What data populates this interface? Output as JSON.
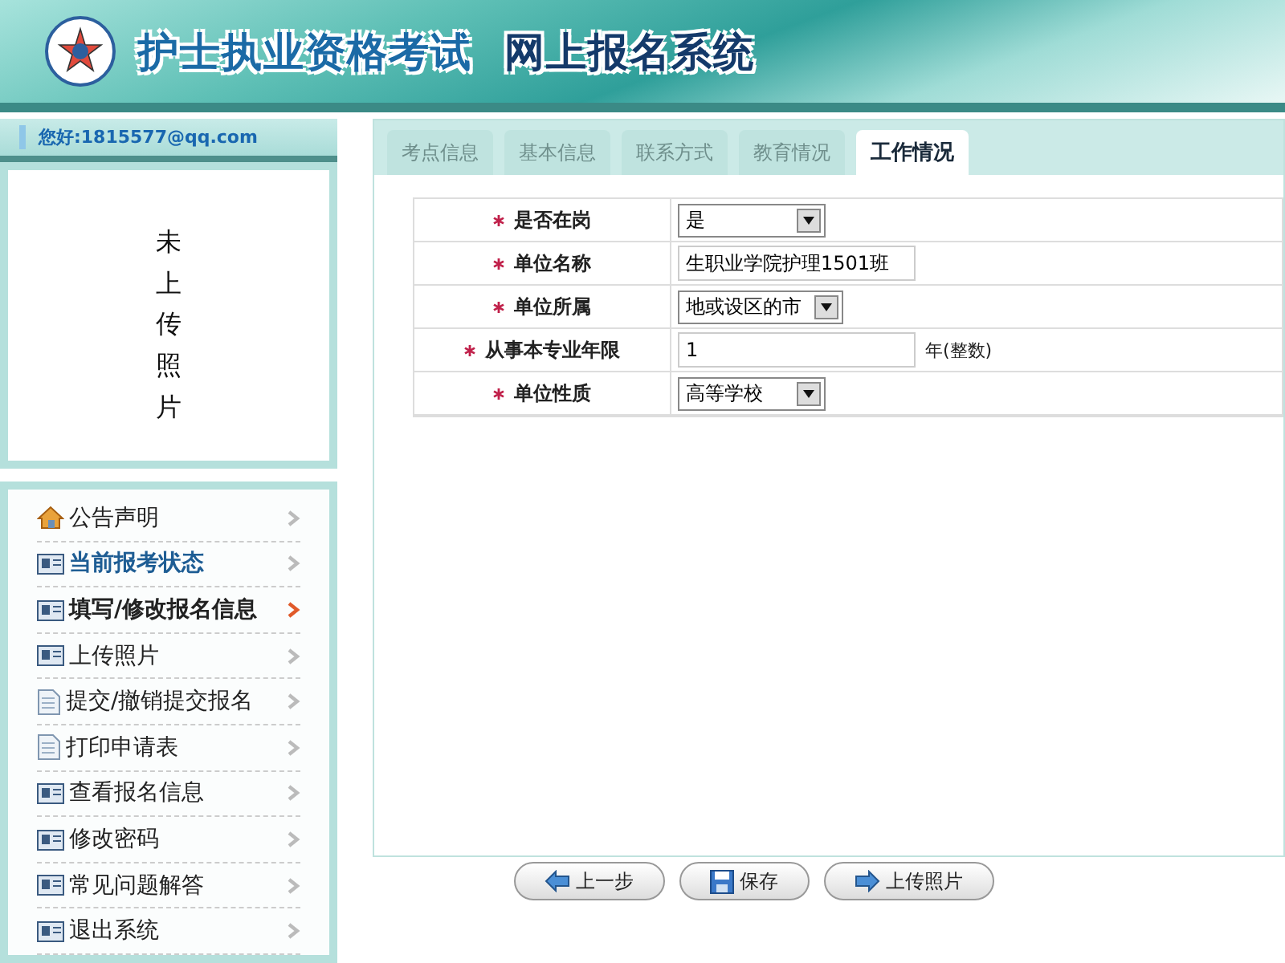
{
  "header": {
    "title": "护士执业资格考试",
    "subtitle": "网上报名系统"
  },
  "sidebar": {
    "greeting": "您好:1815577@qq.com",
    "photo_placeholder": "未上传照片",
    "menu": [
      {
        "label": "公告声明",
        "kind": "house",
        "selected": false,
        "highlighted": false
      },
      {
        "label": "当前报考状态",
        "kind": "card",
        "selected": false,
        "highlighted": true
      },
      {
        "label": "填写/修改报名信息",
        "kind": "card",
        "selected": true,
        "highlighted": false
      },
      {
        "label": "上传照片",
        "kind": "card",
        "selected": false,
        "highlighted": false
      },
      {
        "label": "提交/撤销提交报名",
        "kind": "doc",
        "selected": false,
        "highlighted": false
      },
      {
        "label": "打印申请表",
        "kind": "doc",
        "selected": false,
        "highlighted": false
      },
      {
        "label": "查看报名信息",
        "kind": "card",
        "selected": false,
        "highlighted": false
      },
      {
        "label": "修改密码",
        "kind": "card",
        "selected": false,
        "highlighted": false
      },
      {
        "label": "常见问题解答",
        "kind": "card",
        "selected": false,
        "highlighted": false
      },
      {
        "label": "退出系统",
        "kind": "card",
        "selected": false,
        "highlighted": false
      }
    ]
  },
  "tabs": [
    {
      "label": "考点信息",
      "selected": false
    },
    {
      "label": "基本信息",
      "selected": false
    },
    {
      "label": "联系方式",
      "selected": false
    },
    {
      "label": "教育情况",
      "selected": false
    },
    {
      "label": "工作情况",
      "selected": true
    }
  ],
  "form": {
    "rows": [
      {
        "label": "是否在岗",
        "kind": "select",
        "value": "是",
        "required": true
      },
      {
        "label": "单位名称",
        "kind": "text",
        "value": "生职业学院护理1501班",
        "required": true
      },
      {
        "label": "单位所属",
        "kind": "select",
        "value": "地或设区的市",
        "required": true
      },
      {
        "label": "从事本专业年限",
        "kind": "text",
        "value": "1",
        "suffix": "年(整数)",
        "required": true
      },
      {
        "label": "单位性质",
        "kind": "select",
        "value": "高等学校",
        "required": true
      }
    ]
  },
  "buttons": [
    {
      "label": "上一步",
      "kind": "back"
    },
    {
      "label": "保存",
      "kind": "save"
    },
    {
      "label": "上传照片",
      "kind": "forward"
    }
  ]
}
